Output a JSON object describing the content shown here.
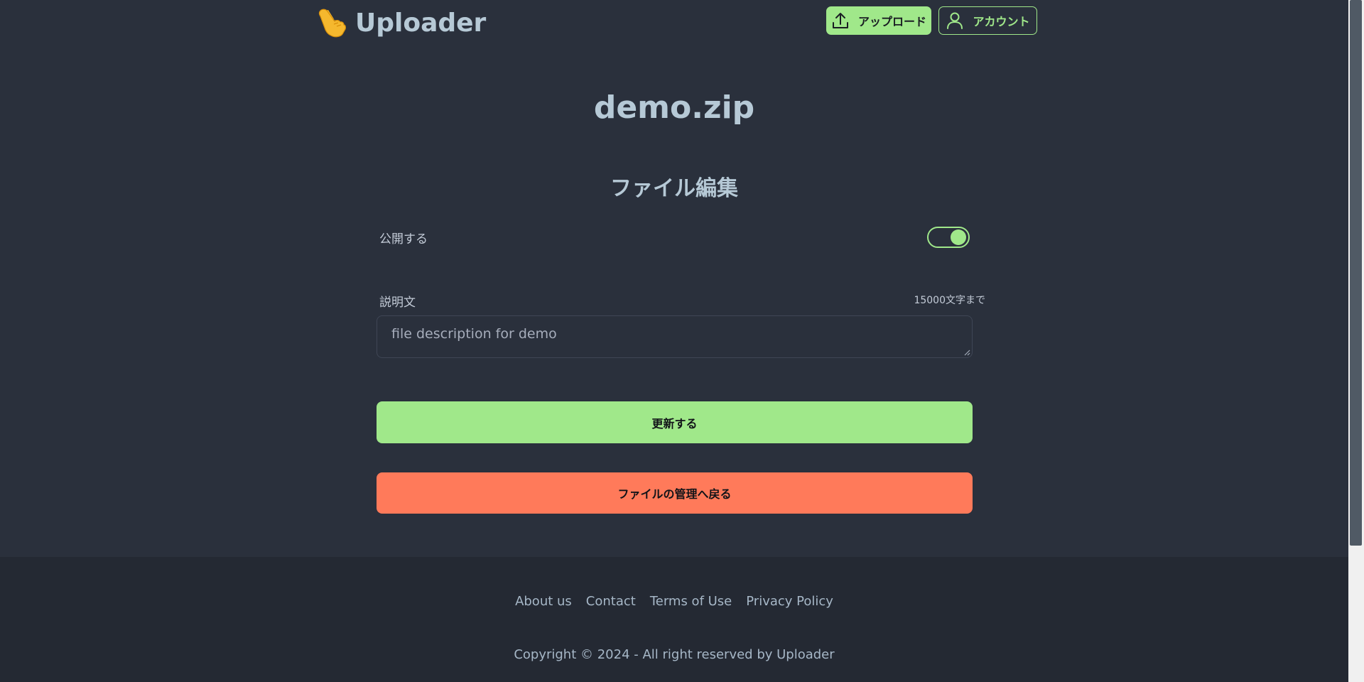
{
  "header": {
    "logo_text": "Uploader",
    "logo_icon": "pointing-hand-emoji",
    "upload_button": "アップロード",
    "account_button": "アカウント"
  },
  "main": {
    "file_name": "demo.zip",
    "section_title": "ファイル編集",
    "public_label": "公開する",
    "public_enabled": true,
    "description_label": "説明文",
    "description_limit": "15000文字まで",
    "description_value": "file description for demo",
    "update_button": "更新する",
    "back_button": "ファイルの管理へ戻る"
  },
  "footer": {
    "links": [
      "About us",
      "Contact",
      "Terms of Use",
      "Privacy Policy"
    ],
    "copyright": "Copyright © 2024 - All right reserved by Uploader"
  },
  "colors": {
    "background": "#2a303c",
    "footer_bg": "#242933",
    "accent_green": "#a0e88a",
    "accent_red": "#ff7a5a",
    "title_text": "#b6c9d6"
  }
}
